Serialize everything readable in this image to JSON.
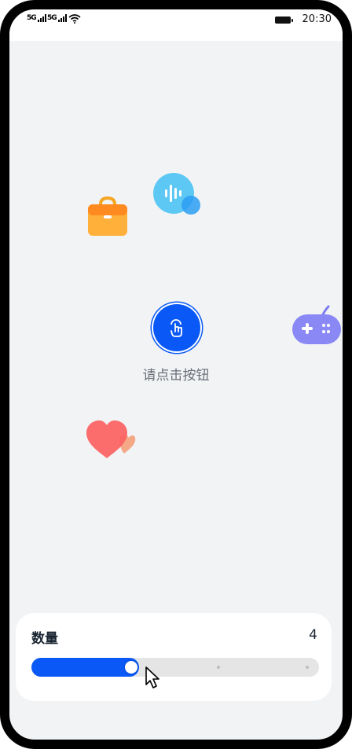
{
  "status_bar": {
    "signal_1": "5G",
    "signal_2": "5G",
    "wifi_icon": "wifi-icon",
    "time": "20:30"
  },
  "floating_icons": [
    "briefcase-icon",
    "voice-bubble-icon",
    "gamepad-icon",
    "heart-icon"
  ],
  "center_button": {
    "icon": "touch-hand-icon",
    "label": "请点击按钮"
  },
  "quantity_panel": {
    "label": "数量",
    "value": "4",
    "slider_fraction": 0.375,
    "steps": 4
  },
  "colors": {
    "accent": "#0a59f7",
    "background": "#f1f3f5",
    "briefcase": "#ffa82e",
    "voice": "#5ac6f5",
    "gamepad": "#7d7bf0",
    "heart": "#fa5f5f"
  }
}
